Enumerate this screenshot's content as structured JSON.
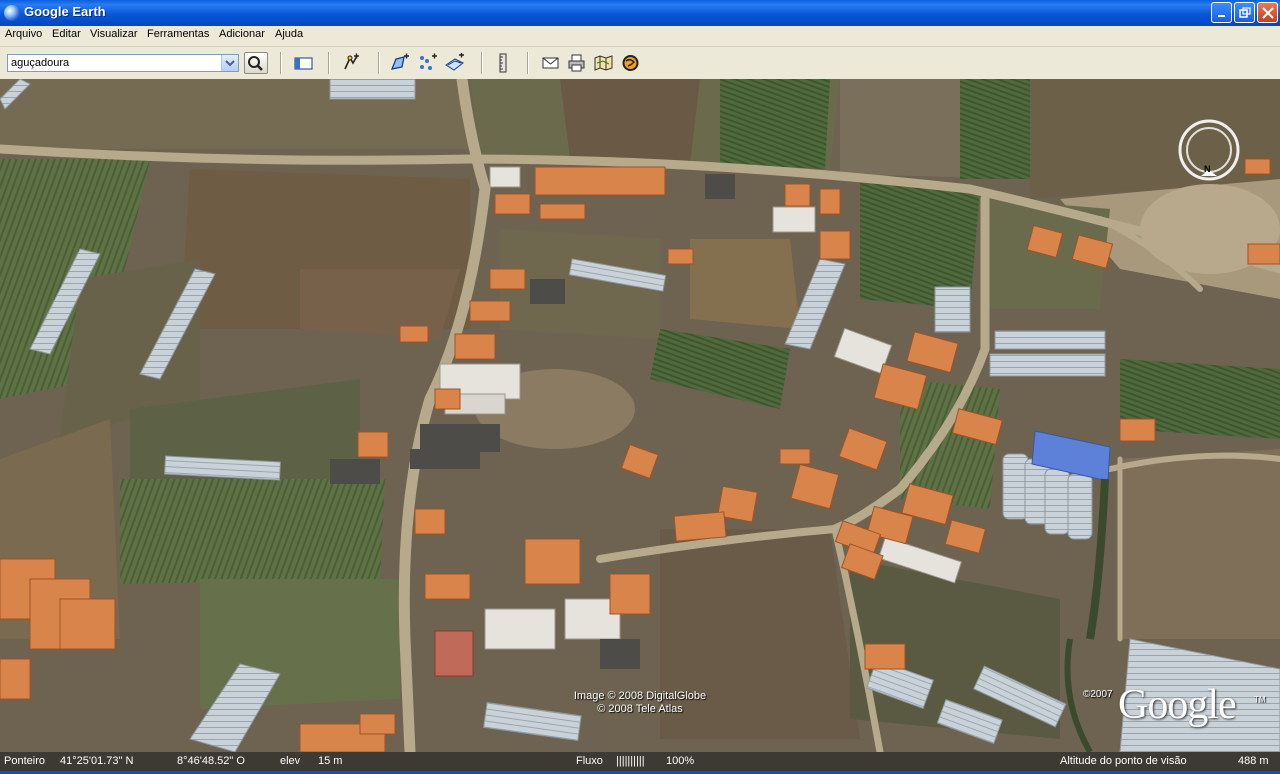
{
  "window": {
    "title": "Google Earth",
    "controls": [
      "minimize-icon",
      "maximize-icon",
      "close-icon"
    ]
  },
  "menu": {
    "items": [
      "Arquivo",
      "Editar",
      "Visualizar",
      "Ferramentas",
      "Adicionar",
      "Ajuda"
    ]
  },
  "toolbar": {
    "search_value": "aguçadoura",
    "buttons": [
      "search-icon",
      "sidebar-toggle-icon",
      "placemark-icon",
      "polygon-icon",
      "path-icon",
      "image-overlay-icon",
      "ruler-icon",
      "email-icon",
      "print-icon",
      "map-icon",
      "earth-icon"
    ]
  },
  "map": {
    "credits_line1": "Image © 2008 DigitalGlobe",
    "credits_line2": "© 2008 Tele Atlas",
    "copyright_year": "©2007",
    "logo": "Google",
    "logo_tm": "TM",
    "compass_label": "N"
  },
  "status": {
    "pointer_label": "Ponteiro",
    "lat": "41°25'01.73\" N",
    "lon": "8°46'48.52\" O",
    "elev_label": "elev",
    "elev_value": "15 m",
    "stream_label": "Fluxo",
    "stream_bar": "||||||||||",
    "stream_percent": "100%",
    "eye_alt_label": "Altitude do ponto de visão",
    "eye_alt_value": "488 m"
  },
  "colors": {
    "titlebar": "#0758d8",
    "chrome": "#ece9d8",
    "statusbar": "#3c3a33",
    "roof": "#d9844a",
    "road": "#b9ab8e"
  }
}
